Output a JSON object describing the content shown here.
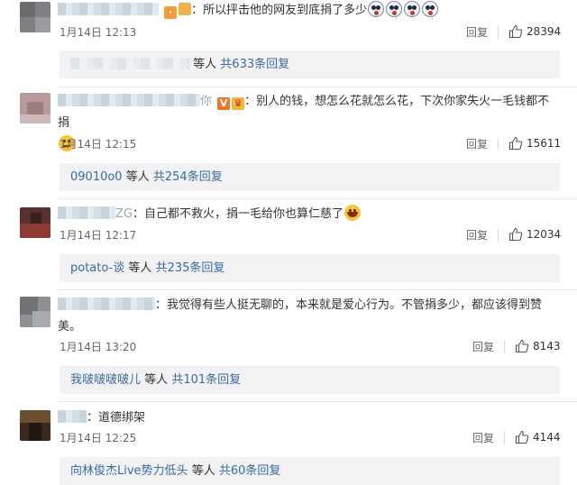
{
  "ui": {
    "reply_label": "回复",
    "others_label": "等人",
    "colors": {
      "link": "#3a6b9c",
      "text": "#333333",
      "meta": "#666666",
      "sub_bg": "#f2f2f5"
    }
  },
  "comments": [
    {
      "name_tail": "",
      "text": "：所以抨击他的网友到底捐了多少",
      "emojis": [
        "shock-face-icon",
        "shock-face-icon",
        "shock-face-icon",
        "shock-face-icon"
      ],
      "date": "1月14日 12:13",
      "likes": "28394",
      "sub_user": "",
      "sub_total": "共633条回复"
    },
    {
      "name_tail": "你",
      "text": "：别人的钱，想怎么花就怎么花，下次你家失火一毛钱都不捐",
      "emojis": [
        "thinking-face-icon"
      ],
      "date": "1月14日 12:15",
      "likes": "15611",
      "sub_user": "09010o0",
      "sub_total": "共254条回复"
    },
    {
      "name_tail": "ZG",
      "text": "：自己都不救火，捐一毛给你也算仁慈了",
      "emojis": [
        "laughing-face-icon"
      ],
      "date": "1月14日 12:17",
      "likes": "12034",
      "sub_user": "potato-谈",
      "sub_total": "共235条回复"
    },
    {
      "name_tail": "",
      "text": "：我觉得有些人挺无聊的，本来就是爱心行为。不管捐多少，都应该得到赞美。",
      "emojis": [],
      "date": "1月14日 13:20",
      "likes": "8143",
      "sub_user": "我啵啵啵啵儿",
      "sub_total": "共101条回复"
    },
    {
      "name_tail": "",
      "text": "：道德绑架",
      "emojis": [],
      "date": "1月14日 12:25",
      "likes": "4144",
      "sub_user": "向林俊杰Live势力低头",
      "sub_total": "共60条回复"
    }
  ]
}
